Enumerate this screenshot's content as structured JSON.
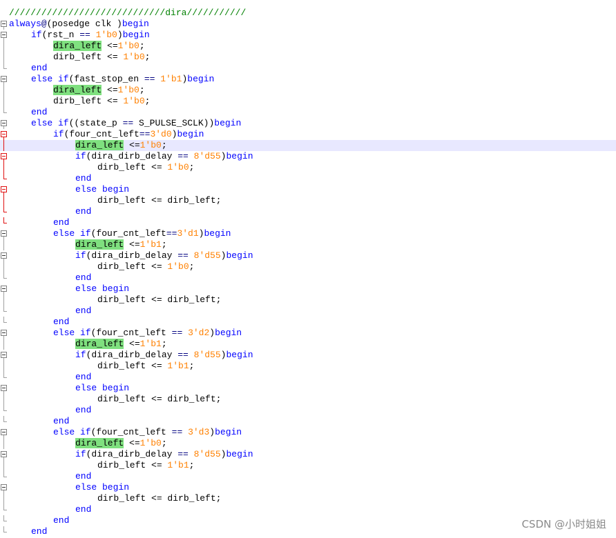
{
  "editor": {
    "current_line": 13,
    "lines": [
      {
        "indent": 0,
        "fold": "none",
        "tokens": [
          [
            "com",
            "/////////////////////////////dira///////////"
          ]
        ]
      },
      {
        "indent": 0,
        "fold": "box",
        "tokens": [
          [
            "kw",
            "always"
          ],
          [
            "op",
            "@"
          ],
          [
            "txt",
            "(posedge clk )"
          ],
          [
            "kw",
            "begin"
          ]
        ]
      },
      {
        "indent": 1,
        "fold": "box",
        "tokens": [
          [
            "kw",
            "if"
          ],
          [
            "txt",
            "(rst_n "
          ],
          [
            "op",
            "=="
          ],
          [
            "txt",
            " "
          ],
          [
            "num",
            "1'b0"
          ],
          [
            "txt",
            ")"
          ],
          [
            "kw",
            "begin"
          ]
        ]
      },
      {
        "indent": 2,
        "fold": "line",
        "tokens": [
          [
            "hl",
            "dira_left"
          ],
          [
            "txt",
            " <="
          ],
          [
            "num",
            "1'b0"
          ],
          [
            "txt",
            ";"
          ]
        ]
      },
      {
        "indent": 2,
        "fold": "line",
        "tokens": [
          [
            "txt",
            "dirb_left <= "
          ],
          [
            "num",
            "1'b0"
          ],
          [
            "txt",
            ";"
          ]
        ]
      },
      {
        "indent": 1,
        "fold": "end",
        "tokens": [
          [
            "kw",
            "end"
          ]
        ]
      },
      {
        "indent": 1,
        "fold": "box",
        "tokens": [
          [
            "kw",
            "else if"
          ],
          [
            "txt",
            "(fast_stop_en "
          ],
          [
            "op",
            "=="
          ],
          [
            "txt",
            " "
          ],
          [
            "num",
            "1'b1"
          ],
          [
            "txt",
            ")"
          ],
          [
            "kw",
            "begin"
          ]
        ]
      },
      {
        "indent": 2,
        "fold": "line",
        "tokens": [
          [
            "hl",
            "dira_left"
          ],
          [
            "txt",
            " <="
          ],
          [
            "num",
            "1'b0"
          ],
          [
            "txt",
            ";"
          ]
        ]
      },
      {
        "indent": 2,
        "fold": "line",
        "tokens": [
          [
            "txt",
            "dirb_left <= "
          ],
          [
            "num",
            "1'b0"
          ],
          [
            "txt",
            ";"
          ]
        ]
      },
      {
        "indent": 1,
        "fold": "end",
        "tokens": [
          [
            "kw",
            "end"
          ]
        ]
      },
      {
        "indent": 1,
        "fold": "box",
        "tokens": [
          [
            "kw",
            "else if"
          ],
          [
            "txt",
            "((state_p "
          ],
          [
            "op",
            "=="
          ],
          [
            "txt",
            " S_PULSE_SCLK))"
          ],
          [
            "kw",
            "begin"
          ]
        ]
      },
      {
        "indent": 2,
        "fold": "redbox",
        "tokens": [
          [
            "kw",
            "if"
          ],
          [
            "txt",
            "(four_cnt_left"
          ],
          [
            "op",
            "=="
          ],
          [
            "num",
            "3'd0"
          ],
          [
            "txt",
            ")"
          ],
          [
            "kw",
            "begin"
          ]
        ]
      },
      {
        "indent": 3,
        "fold": "redline",
        "tokens": [
          [
            "hl",
            "dira_left"
          ],
          [
            "txt",
            " <="
          ],
          [
            "num",
            "1'b0"
          ],
          [
            "txt",
            ";"
          ]
        ]
      },
      {
        "indent": 3,
        "fold": "redbox",
        "tokens": [
          [
            "kw",
            "if"
          ],
          [
            "txt",
            "(dira_dirb_delay "
          ],
          [
            "op",
            "=="
          ],
          [
            "txt",
            " "
          ],
          [
            "num",
            "8'd55"
          ],
          [
            "txt",
            ")"
          ],
          [
            "kw",
            "begin"
          ]
        ]
      },
      {
        "indent": 4,
        "fold": "redline",
        "tokens": [
          [
            "txt",
            "dirb_left <= "
          ],
          [
            "num",
            "1'b0"
          ],
          [
            "txt",
            ";"
          ]
        ]
      },
      {
        "indent": 3,
        "fold": "redend",
        "tokens": [
          [
            "kw",
            "end"
          ]
        ]
      },
      {
        "indent": 3,
        "fold": "redbox",
        "tokens": [
          [
            "kw",
            "else begin"
          ]
        ]
      },
      {
        "indent": 4,
        "fold": "redline",
        "tokens": [
          [
            "txt",
            "dirb_left <= dirb_left;"
          ]
        ]
      },
      {
        "indent": 3,
        "fold": "redend",
        "tokens": [
          [
            "kw",
            "end"
          ]
        ]
      },
      {
        "indent": 2,
        "fold": "redend",
        "tokens": [
          [
            "kw",
            "end"
          ]
        ]
      },
      {
        "indent": 2,
        "fold": "box",
        "tokens": [
          [
            "kw",
            "else if"
          ],
          [
            "txt",
            "(four_cnt_left"
          ],
          [
            "op",
            "=="
          ],
          [
            "num",
            "3'd1"
          ],
          [
            "txt",
            ")"
          ],
          [
            "kw",
            "begin"
          ]
        ]
      },
      {
        "indent": 3,
        "fold": "line",
        "tokens": [
          [
            "hl",
            "dira_left"
          ],
          [
            "txt",
            " <="
          ],
          [
            "num",
            "1'b1"
          ],
          [
            "txt",
            ";"
          ]
        ]
      },
      {
        "indent": 3,
        "fold": "box",
        "tokens": [
          [
            "kw",
            "if"
          ],
          [
            "txt",
            "(dira_dirb_delay "
          ],
          [
            "op",
            "=="
          ],
          [
            "txt",
            " "
          ],
          [
            "num",
            "8'd55"
          ],
          [
            "txt",
            ")"
          ],
          [
            "kw",
            "begin"
          ]
        ]
      },
      {
        "indent": 4,
        "fold": "line",
        "tokens": [
          [
            "txt",
            "dirb_left <= "
          ],
          [
            "num",
            "1'b0"
          ],
          [
            "txt",
            ";"
          ]
        ]
      },
      {
        "indent": 3,
        "fold": "end",
        "tokens": [
          [
            "kw",
            "end"
          ]
        ]
      },
      {
        "indent": 3,
        "fold": "box",
        "tokens": [
          [
            "kw",
            "else begin"
          ]
        ]
      },
      {
        "indent": 4,
        "fold": "line",
        "tokens": [
          [
            "txt",
            "dirb_left <= dirb_left;"
          ]
        ]
      },
      {
        "indent": 3,
        "fold": "end",
        "tokens": [
          [
            "kw",
            "end"
          ]
        ]
      },
      {
        "indent": 2,
        "fold": "end",
        "tokens": [
          [
            "kw",
            "end"
          ]
        ]
      },
      {
        "indent": 2,
        "fold": "box",
        "tokens": [
          [
            "kw",
            "else if"
          ],
          [
            "txt",
            "(four_cnt_left "
          ],
          [
            "op",
            "=="
          ],
          [
            "txt",
            " "
          ],
          [
            "num",
            "3'd2"
          ],
          [
            "txt",
            ")"
          ],
          [
            "kw",
            "begin"
          ]
        ]
      },
      {
        "indent": 3,
        "fold": "line",
        "tokens": [
          [
            "hl",
            "dira_left"
          ],
          [
            "txt",
            " <="
          ],
          [
            "num",
            "1'b1"
          ],
          [
            "txt",
            ";"
          ]
        ]
      },
      {
        "indent": 3,
        "fold": "box",
        "tokens": [
          [
            "kw",
            "if"
          ],
          [
            "txt",
            "(dira_dirb_delay "
          ],
          [
            "op",
            "=="
          ],
          [
            "txt",
            " "
          ],
          [
            "num",
            "8'd55"
          ],
          [
            "txt",
            ")"
          ],
          [
            "kw",
            "begin"
          ]
        ]
      },
      {
        "indent": 4,
        "fold": "line",
        "tokens": [
          [
            "txt",
            "dirb_left <= "
          ],
          [
            "num",
            "1'b1"
          ],
          [
            "txt",
            ";"
          ]
        ]
      },
      {
        "indent": 3,
        "fold": "end",
        "tokens": [
          [
            "kw",
            "end"
          ]
        ]
      },
      {
        "indent": 3,
        "fold": "box",
        "tokens": [
          [
            "kw",
            "else begin"
          ]
        ]
      },
      {
        "indent": 4,
        "fold": "line",
        "tokens": [
          [
            "txt",
            "dirb_left <= dirb_left;"
          ]
        ]
      },
      {
        "indent": 3,
        "fold": "end",
        "tokens": [
          [
            "kw",
            "end"
          ]
        ]
      },
      {
        "indent": 2,
        "fold": "end",
        "tokens": [
          [
            "kw",
            "end"
          ]
        ]
      },
      {
        "indent": 2,
        "fold": "box",
        "tokens": [
          [
            "kw",
            "else if"
          ],
          [
            "txt",
            "(four_cnt_left "
          ],
          [
            "op",
            "=="
          ],
          [
            "txt",
            " "
          ],
          [
            "num",
            "3'd3"
          ],
          [
            "txt",
            ")"
          ],
          [
            "kw",
            "begin"
          ]
        ]
      },
      {
        "indent": 3,
        "fold": "line",
        "tokens": [
          [
            "hl",
            "dira_left"
          ],
          [
            "txt",
            " <="
          ],
          [
            "num",
            "1'b0"
          ],
          [
            "txt",
            ";"
          ]
        ]
      },
      {
        "indent": 3,
        "fold": "box",
        "tokens": [
          [
            "kw",
            "if"
          ],
          [
            "txt",
            "(dira_dirb_delay "
          ],
          [
            "op",
            "=="
          ],
          [
            "txt",
            " "
          ],
          [
            "num",
            "8'd55"
          ],
          [
            "txt",
            ")"
          ],
          [
            "kw",
            "begin"
          ]
        ]
      },
      {
        "indent": 4,
        "fold": "line",
        "tokens": [
          [
            "txt",
            "dirb_left <= "
          ],
          [
            "num",
            "1'b1"
          ],
          [
            "txt",
            ";"
          ]
        ]
      },
      {
        "indent": 3,
        "fold": "end",
        "tokens": [
          [
            "kw",
            "end"
          ]
        ]
      },
      {
        "indent": 3,
        "fold": "box",
        "tokens": [
          [
            "kw",
            "else begin"
          ]
        ]
      },
      {
        "indent": 4,
        "fold": "line",
        "tokens": [
          [
            "txt",
            "dirb_left <= dirb_left;"
          ]
        ]
      },
      {
        "indent": 3,
        "fold": "end",
        "tokens": [
          [
            "kw",
            "end"
          ]
        ]
      },
      {
        "indent": 2,
        "fold": "end",
        "tokens": [
          [
            "kw",
            "end"
          ]
        ]
      },
      {
        "indent": 1,
        "fold": "end",
        "tokens": [
          [
            "kw",
            "end"
          ]
        ]
      }
    ]
  },
  "colors": {
    "keyword": "#0000ff",
    "number": "#ff8000",
    "comment": "#008000",
    "highlight": "#7fe07f",
    "current_line": "#e8e8ff",
    "fold_red": "#e01010"
  },
  "watermark": "CSDN @小时姐姐"
}
